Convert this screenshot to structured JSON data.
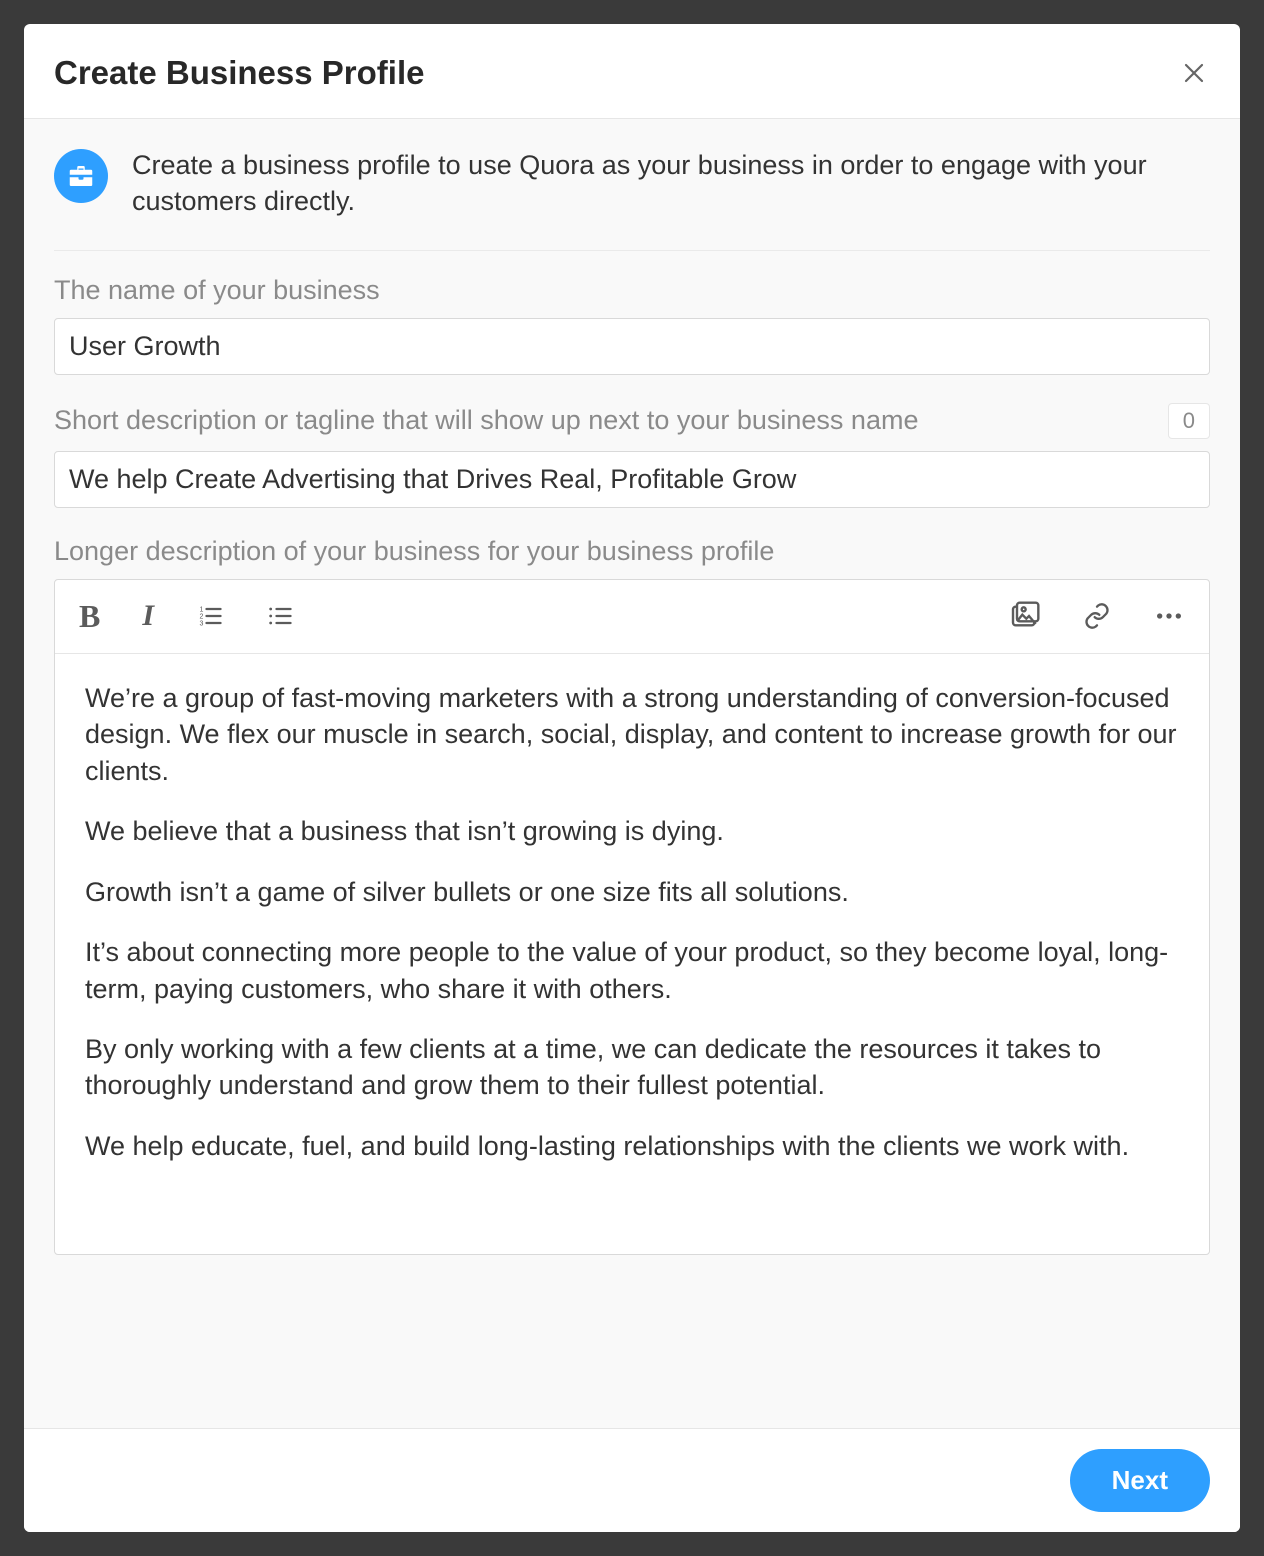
{
  "modal": {
    "title": "Create Business Profile",
    "intro": "Create a business profile to use Quora as your business in order to engage with your customers directly.",
    "fields": {
      "name_label": "The name of your business",
      "name_value": "User Growth",
      "tagline_label": "Short description or tagline that will show up next to your business name",
      "tagline_value": "We help Create Advertising that Drives Real, Profitable Grow",
      "tagline_counter": "0",
      "long_label": "Longer description of your business for your business profile",
      "long_paragraphs": [
        "We’re a group of fast-moving marketers with a strong understanding of conversion-focused design. We flex our muscle in search, social, display, and content to increase growth for our clients.",
        "We believe that a business that isn’t growing is dying.",
        "Growth isn’t a game of silver bullets or one size fits all solutions.",
        "It’s about connecting more people to the value of your product, so they become loyal, long-term, paying customers, who share it with others.",
        "By only working with a few clients at a time, we can dedicate the resources it takes to thoroughly understand and grow them to their fullest potential.",
        "We help educate, fuel, and build long-lasting relationships with the clients we work with."
      ]
    },
    "footer": {
      "next_label": "Next"
    }
  }
}
